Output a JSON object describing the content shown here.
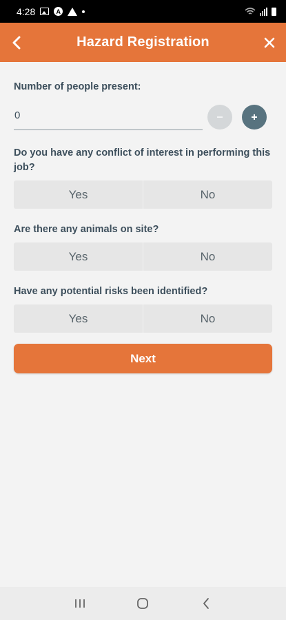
{
  "status_bar": {
    "time": "4:28",
    "icons": [
      "image-icon",
      "a-circle-icon",
      "warning-icon",
      "dot-icon",
      "wifi-icon",
      "signal-icon",
      "battery-icon"
    ]
  },
  "header": {
    "title": "Hazard Registration",
    "back_icon": "chevron-left-icon",
    "close_icon": "close-icon",
    "color": "#e5753a"
  },
  "people_count": {
    "label": "Number of people present:",
    "value": "0",
    "decrement_icon": "minus-icon",
    "increment_icon": "plus-icon"
  },
  "questions": [
    {
      "text": "Do you have any conflict of interest in performing this job?",
      "yes": "Yes",
      "no": "No"
    },
    {
      "text": "Are there any animals on site?",
      "yes": "Yes",
      "no": "No"
    },
    {
      "text": "Have any potential risks been identified?",
      "yes": "Yes",
      "no": "No"
    }
  ],
  "next_button": {
    "label": "Next"
  },
  "nav_bar": {
    "icons": [
      "recent-apps-icon",
      "home-icon",
      "back-icon"
    ]
  },
  "colors": {
    "accent": "#e5753a",
    "primary_text": "#3d4f5c",
    "stepper_active": "#58737f",
    "stepper_disabled": "#d4d7d9"
  }
}
